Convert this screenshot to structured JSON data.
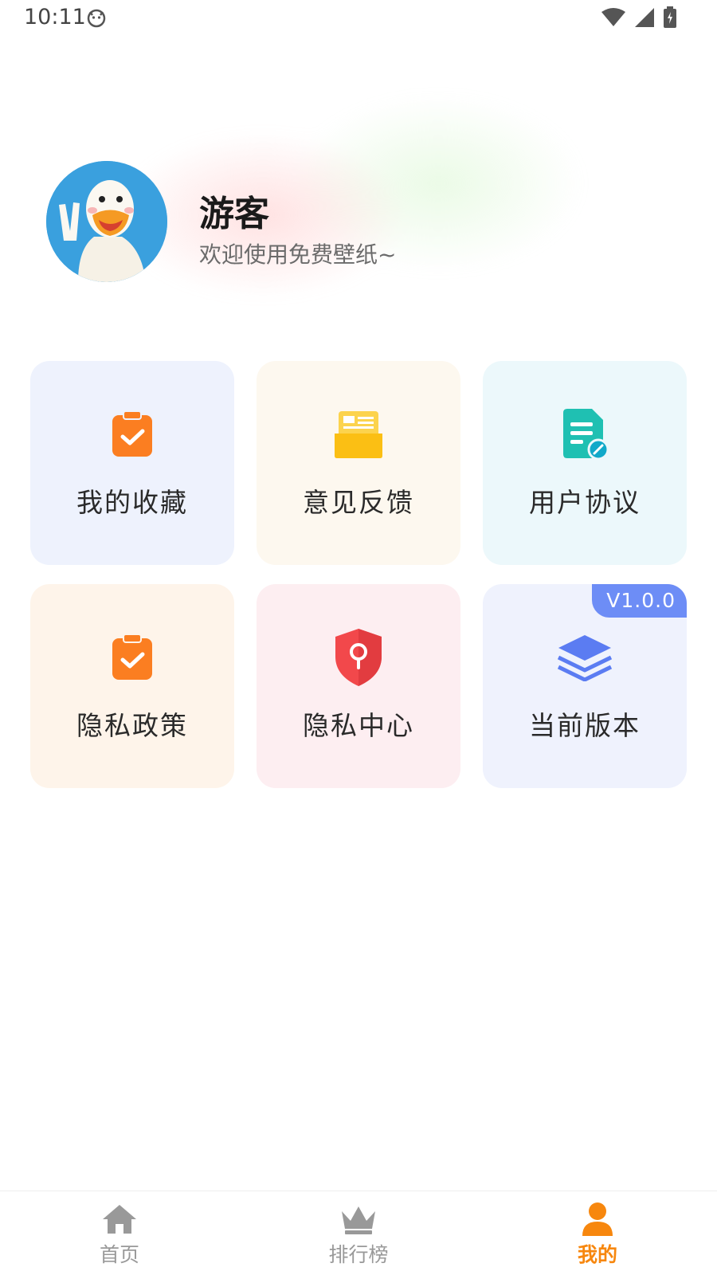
{
  "status_bar": {
    "time": "10:11"
  },
  "profile": {
    "name": "游客",
    "subtitle": "欢迎使用免费壁纸~"
  },
  "menu": {
    "items": [
      {
        "label": "我的收藏",
        "icon": "clipboard-check-icon"
      },
      {
        "label": "意见反馈",
        "icon": "feedback-folder-icon"
      },
      {
        "label": "用户协议",
        "icon": "document-edit-icon"
      },
      {
        "label": "隐私政策",
        "icon": "clipboard-check-icon"
      },
      {
        "label": "隐私中心",
        "icon": "shield-lock-icon"
      },
      {
        "label": "当前版本",
        "icon": "layers-icon",
        "badge": "V1.0.0"
      }
    ]
  },
  "tabbar": {
    "tabs": [
      {
        "label": "首页",
        "icon": "home-icon"
      },
      {
        "label": "排行榜",
        "icon": "crown-icon"
      },
      {
        "label": "我的",
        "icon": "user-icon",
        "active": true
      }
    ]
  },
  "colors": {
    "accent": "#f7870e",
    "badge": "#6d8df6"
  }
}
